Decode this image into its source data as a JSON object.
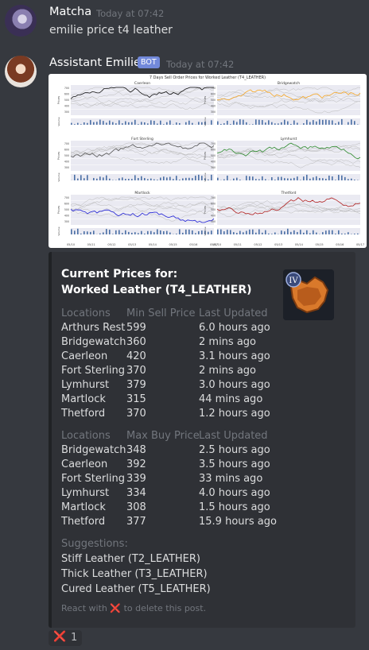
{
  "messages": [
    {
      "author": "Matcha",
      "timestamp": "Today at 07:42",
      "text": "emilie price t4 leather"
    },
    {
      "author": "Assistant Emilie",
      "badge": "BOT",
      "timestamp": "Today at 07:42"
    }
  ],
  "chart": {
    "title": "7 Days Sell Order Prices for Worked Leather (T4_LEATHER)",
    "panels": [
      "Caerleon",
      "Bridgewatch",
      "Fort Sterling",
      "Lymhurst",
      "Martlock",
      "Thetford"
    ],
    "panel_colors": [
      "#111111",
      "#f5a623",
      "#555555",
      "#2e8b2e",
      "#1f1fd6",
      "#b22222"
    ],
    "ylabel": "Prices",
    "vlabel": "Volume",
    "yticks": [
      "700",
      "600",
      "500",
      "400",
      "300"
    ],
    "xticks": [
      "05/10",
      "05/11",
      "05/12",
      "05/13",
      "05/14",
      "05/15",
      "05/16",
      "05/17"
    ]
  },
  "embed": {
    "title_line1": "Current Prices for:",
    "title_line2": "Worked Leather (T4_LEATHER)",
    "thumb_label": "IV",
    "sell": {
      "headers": [
        "Locations",
        "Min Sell Price",
        "Last Updated"
      ],
      "rows": [
        [
          "Arthurs Rest",
          "599",
          "6.0 hours ago"
        ],
        [
          "Bridgewatch",
          "360",
          "2 mins ago"
        ],
        [
          "Caerleon",
          "420",
          "3.1 hours ago"
        ],
        [
          "Fort Sterling",
          "370",
          "2 mins ago"
        ],
        [
          "Lymhurst",
          "379",
          "3.0 hours ago"
        ],
        [
          "Martlock",
          "315",
          "44 mins ago"
        ],
        [
          "Thetford",
          "370",
          "1.2 hours ago"
        ]
      ]
    },
    "buy": {
      "headers": [
        "Locations",
        "Max Buy Price",
        "Last Updated"
      ],
      "rows": [
        [
          "Bridgewatch",
          "348",
          "2.5 hours ago"
        ],
        [
          "Caerleon",
          "392",
          "3.5 hours ago"
        ],
        [
          "Fort Sterling",
          "339",
          "33 mins ago"
        ],
        [
          "Lymhurst",
          "334",
          "4.0 hours ago"
        ],
        [
          "Martlock",
          "308",
          "1.5 hours ago"
        ],
        [
          "Thetford",
          "377",
          "15.9 hours ago"
        ]
      ]
    },
    "suggestions_label": "Suggestions:",
    "suggestions": [
      "Stiff Leather (T2_LEATHER)",
      "Thick Leather (T3_LEATHER)",
      "Cured Leather (T5_LEATHER)"
    ],
    "footer_before": "React with",
    "footer_emoji": "❌",
    "footer_after": "to delete this post."
  },
  "reaction": {
    "emoji": "❌",
    "count": "1"
  },
  "colors": {
    "background": "#36393f",
    "embed_bg": "#2f3136",
    "bot_badge": "#7289da",
    "muted": "#72767d",
    "text": "#dcddde"
  },
  "icons": {
    "reaction": "cross-mark-icon",
    "thumbnail": "worked-leather-item-icon"
  }
}
